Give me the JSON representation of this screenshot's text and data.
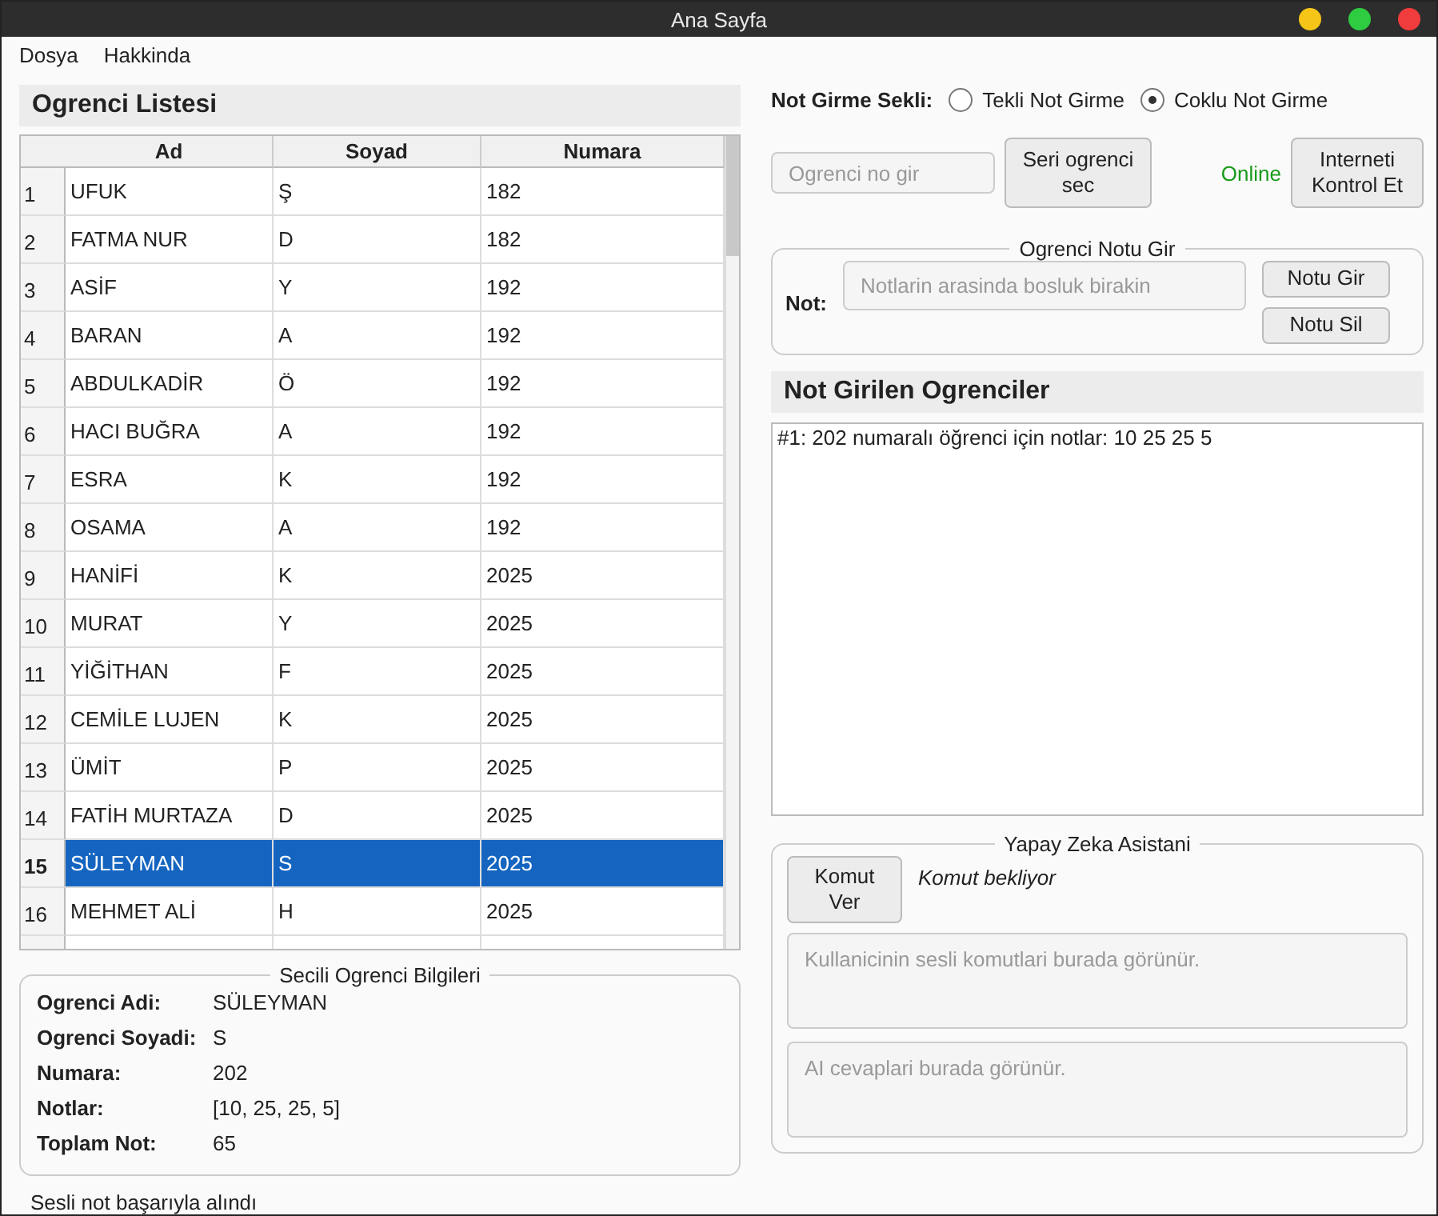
{
  "window": {
    "title": "Ana Sayfa"
  },
  "menu": [
    "Dosya",
    "Hakkinda"
  ],
  "student_list": {
    "title": "Ogrenci Listesi",
    "columns": [
      "Ad",
      "Soyad",
      "Numara"
    ],
    "rows": [
      {
        "index": "1",
        "name": "UFUK",
        "surname": "Ş",
        "number": "182",
        "selected": false
      },
      {
        "index": "2",
        "name": "FATMA NUR",
        "surname": "D",
        "number": "182",
        "selected": false
      },
      {
        "index": "3",
        "name": "ASİF",
        "surname": "Y",
        "number": "192",
        "selected": false
      },
      {
        "index": "4",
        "name": "BARAN",
        "surname": "A",
        "number": "192",
        "selected": false
      },
      {
        "index": "5",
        "name": "ABDULKADİR",
        "surname": "Ö",
        "number": "192",
        "selected": false
      },
      {
        "index": "6",
        "name": "HACI BUĞRA",
        "surname": "A",
        "number": "192",
        "selected": false
      },
      {
        "index": "7",
        "name": "ESRA",
        "surname": "K",
        "number": "192",
        "selected": false
      },
      {
        "index": "8",
        "name": "OSAMA",
        "surname": "A",
        "number": "192",
        "selected": false
      },
      {
        "index": "9",
        "name": "HANİFİ",
        "surname": "K",
        "number": "2025",
        "selected": false
      },
      {
        "index": "10",
        "name": "MURAT",
        "surname": "Y",
        "number": "2025",
        "selected": false
      },
      {
        "index": "11",
        "name": "YİĞİTHAN",
        "surname": "F",
        "number": "2025",
        "selected": false
      },
      {
        "index": "12",
        "name": "CEMİLE LUJEN",
        "surname": "K",
        "number": "2025",
        "selected": false
      },
      {
        "index": "13",
        "name": "ÜMİT",
        "surname": "P",
        "number": "2025",
        "selected": false
      },
      {
        "index": "14",
        "name": "FATİH MURTAZA",
        "surname": "D",
        "number": "2025",
        "selected": false
      },
      {
        "index": "15",
        "name": "SÜLEYMAN",
        "surname": "S",
        "number": "2025",
        "selected": true
      },
      {
        "index": "16",
        "name": "MEHMET ALİ",
        "surname": "H",
        "number": "2025",
        "selected": false
      }
    ]
  },
  "selected_info": {
    "title": "Secili Ogrenci Bilgileri",
    "fields": [
      {
        "label": "Ogrenci Adi:",
        "value": "SÜLEYMAN"
      },
      {
        "label": "Ogrenci Soyadi:",
        "value": "S"
      },
      {
        "label": "Numara:",
        "value": "202"
      },
      {
        "label": "Notlar:",
        "value": "[10, 25, 25, 5]"
      },
      {
        "label": "Toplam Not:",
        "value": "65"
      }
    ]
  },
  "status_bar": "Sesli not başarıyla alındı",
  "entry_mode": {
    "label": "Not Girme Sekli:",
    "options": [
      {
        "label": "Tekli Not Girme",
        "selected": false
      },
      {
        "label": "Coklu Not Girme",
        "selected": true
      }
    ]
  },
  "student_no": {
    "placeholder": "Ogrenci no gir"
  },
  "series_button": "Seri ogrenci sec",
  "connection": {
    "status": "Online",
    "online": true,
    "button": "Interneti Kontrol Et"
  },
  "grade_entry": {
    "title": "Ogrenci Notu Gir",
    "label": "Not:",
    "placeholder": "Notlarin arasinda bosluk birakin",
    "buttons": [
      "Notu Gir",
      "Notu Sil"
    ]
  },
  "graded_students": {
    "title": "Not Girilen Ogrenciler",
    "entries": [
      "#1: 202 numaralı öğrenci için notlar: 10 25 25 5"
    ]
  },
  "assistant": {
    "title": "Yapay Zeka Asistani",
    "button": "Komut Ver",
    "status": "Komut bekliyor",
    "command_placeholder": "Kullanicinin sesli komutlari burada görünür.",
    "response_placeholder": "AI cevaplari burada görünür."
  }
}
